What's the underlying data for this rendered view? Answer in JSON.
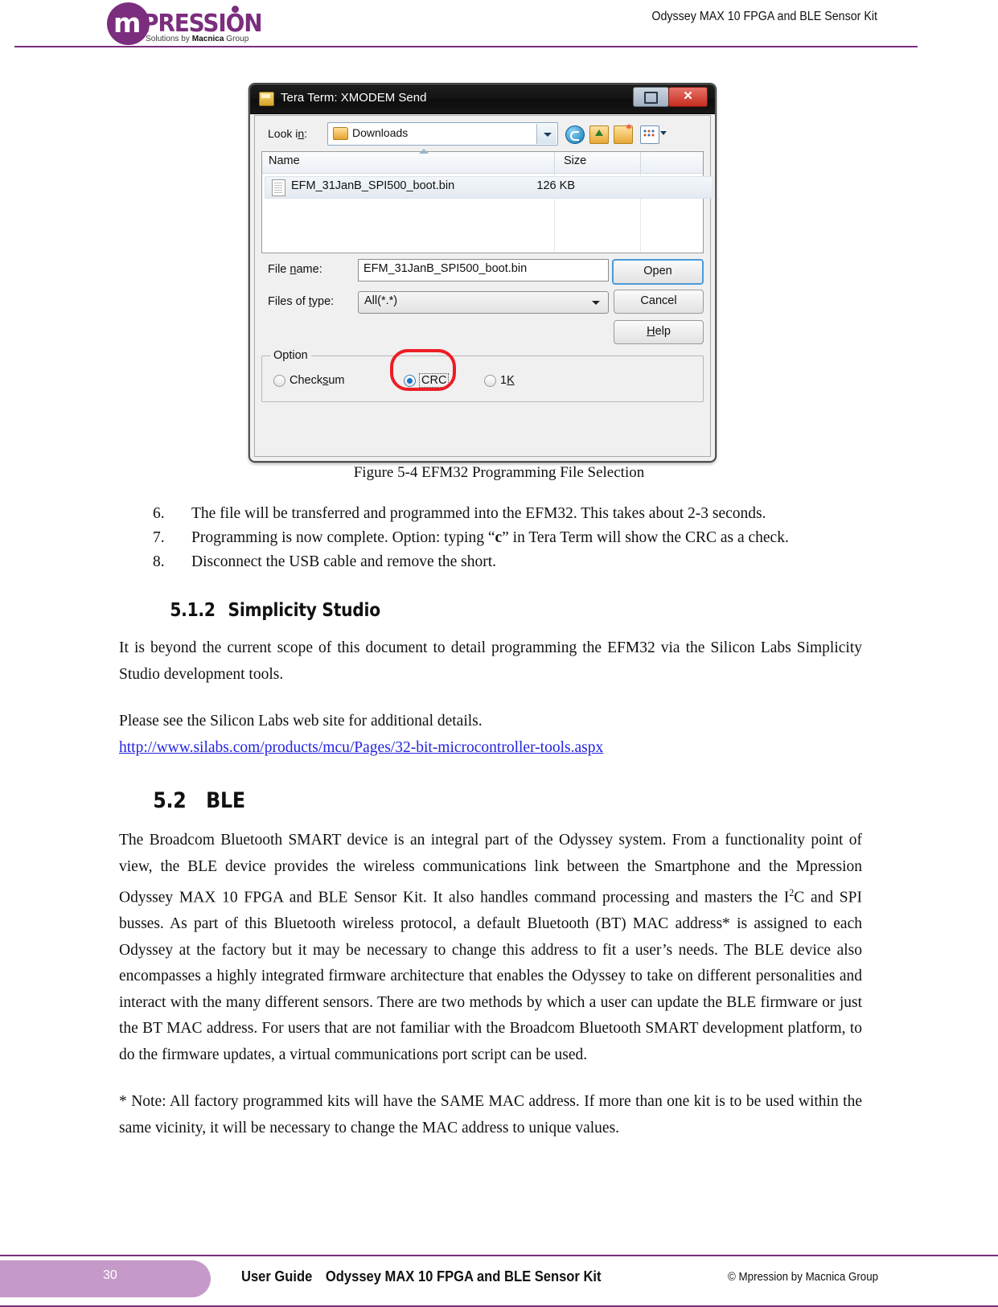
{
  "header": {
    "logo_m": "m",
    "logo_pression": "PRESSION",
    "logo_sub_pre": "Solutions by ",
    "logo_sub_bold": "Macnica",
    "logo_sub_post": " Group",
    "title": "Odyssey MAX 10 FPGA and BLE Sensor Kit",
    "accent_color": "#7B2D7E"
  },
  "figure": {
    "dialog": {
      "title": "Tera Term: XMODEM Send",
      "restore_button": "restore",
      "close_button": "✕",
      "look_in_label": "Look in:",
      "look_in_value": "Downloads",
      "toolbar_icons": [
        "back-icon",
        "up-one-level-icon",
        "new-folder-icon",
        "views-icon"
      ],
      "columns": [
        "Name",
        "Size"
      ],
      "rows": [
        {
          "name": "EFM_31JanB_SPI500_boot.bin",
          "size": "126 KB"
        }
      ],
      "file_name_label": "File name:",
      "file_name_value": "EFM_31JanB_SPI500_boot.bin",
      "files_of_type_label": "Files of type:",
      "files_of_type_value": "All(*.*)",
      "buttons": {
        "open": "Open",
        "cancel": "Cancel",
        "help": "Help"
      },
      "option_group_label": "Option",
      "radios": [
        {
          "label": "Checksum",
          "selected": false
        },
        {
          "label": "CRC",
          "selected": true
        },
        {
          "label": "1K",
          "selected": false
        }
      ],
      "highlight_color": "#ee1c24"
    },
    "caption": "Figure 5-4 EFM32 Programming File Selection"
  },
  "steps": [
    {
      "num": "6.",
      "text": "The file will be transferred and programmed into the EFM32.   This takes about 2-3 seconds."
    },
    {
      "num": "7.",
      "text_a": "Programming is now complete.   Option: typing “",
      "bold": "c",
      "text_b": "” in Tera Term will show the CRC as a check."
    },
    {
      "num": "8.",
      "text": "Disconnect the USB cable and remove the short."
    }
  ],
  "section_512": {
    "number": "5.1.2",
    "title": "Simplicity Studio",
    "paragraph": "It is beyond the current scope of this document to detail programming the EFM32 via the Silicon Labs Simplicity Studio development tools.",
    "see_also": "Please see the Silicon Labs web site for additional details.",
    "link": "http://www.silabs.com/products/mcu/Pages/32-bit-microcontroller-tools.aspx",
    "link_color": "#2323dd"
  },
  "section_52": {
    "number": "5.2",
    "title": "BLE",
    "paragraph_a": "The Broadcom Bluetooth SMART device is an integral part of the Odyssey system.  From a functionality point of view, the BLE device provides the wireless communications link between the Smartphone and the Mpression Odyssey MAX 10 FPGA and BLE Sensor Kit.  It also handles command processing and masters the I",
    "superscript": "2",
    "paragraph_b": "C and SPI busses.  As part of this Bluetooth wireless protocol, a default Bluetooth (BT) MAC address* is assigned to each Odyssey at the factory but it may be necessary to change this address to fit a user’s needs. The BLE device also encompasses a highly integrated firmware architecture that enables the Odyssey to take on different personalities and interact with the many different sensors.   There are two methods by which a user can update the BLE firmware or just the BT MAC address.   For users that are not familiar with the Broadcom Bluetooth SMART development platform, to do the firmware updates, a virtual communications port script can be used.",
    "note": "* Note: All factory programmed kits will have the SAME MAC address.   If more than one kit is to be used within the same vicinity, it will be necessary to change the MAC address to unique values."
  },
  "footer": {
    "page_number": "30",
    "center_a": "User Guide",
    "center_b": "Odyssey MAX 10 FPGA and BLE Sensor Kit",
    "right": "©  Mpression  by  Macnica  Group",
    "tab_color": "#c59ac8"
  }
}
